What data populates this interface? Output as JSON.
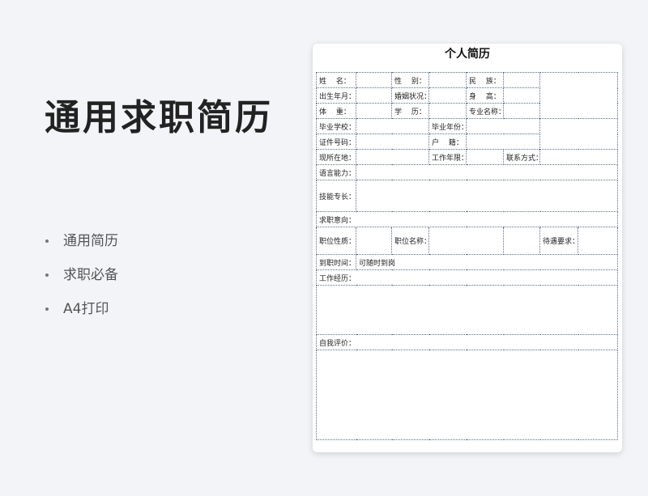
{
  "promo": {
    "title": "通用求职简历",
    "features": [
      "通用简历",
      "求职必备",
      "A4打印"
    ]
  },
  "resume": {
    "title": "个人简历",
    "labels": {
      "name": "姓　 名：",
      "gender": "性　 别：",
      "ethnicity": "民　 族：",
      "birth": "出生年月：",
      "marital": "婚姻状况：",
      "height": "身　 高：",
      "weight": "体　 重：",
      "education": "学　 历：",
      "major": "专业名称：",
      "school": "毕业学校：",
      "grad_year": "毕业年份：",
      "id_number": "证件号码：",
      "hukou": "户　 籍：",
      "location": "现所在地：",
      "work_years": "工作年限：",
      "contact": "联系方式：",
      "language": "语言能力：",
      "skills": "技能专长：",
      "intention": "求职意向：",
      "job_type": "职位性质：",
      "job_title": "职位名称：",
      "salary": "待遇要求：",
      "start_time": "到职时间：",
      "experience": "工作经历：",
      "self_eval": "自我评价："
    },
    "values": {
      "start_time": "可随时到岗"
    }
  }
}
